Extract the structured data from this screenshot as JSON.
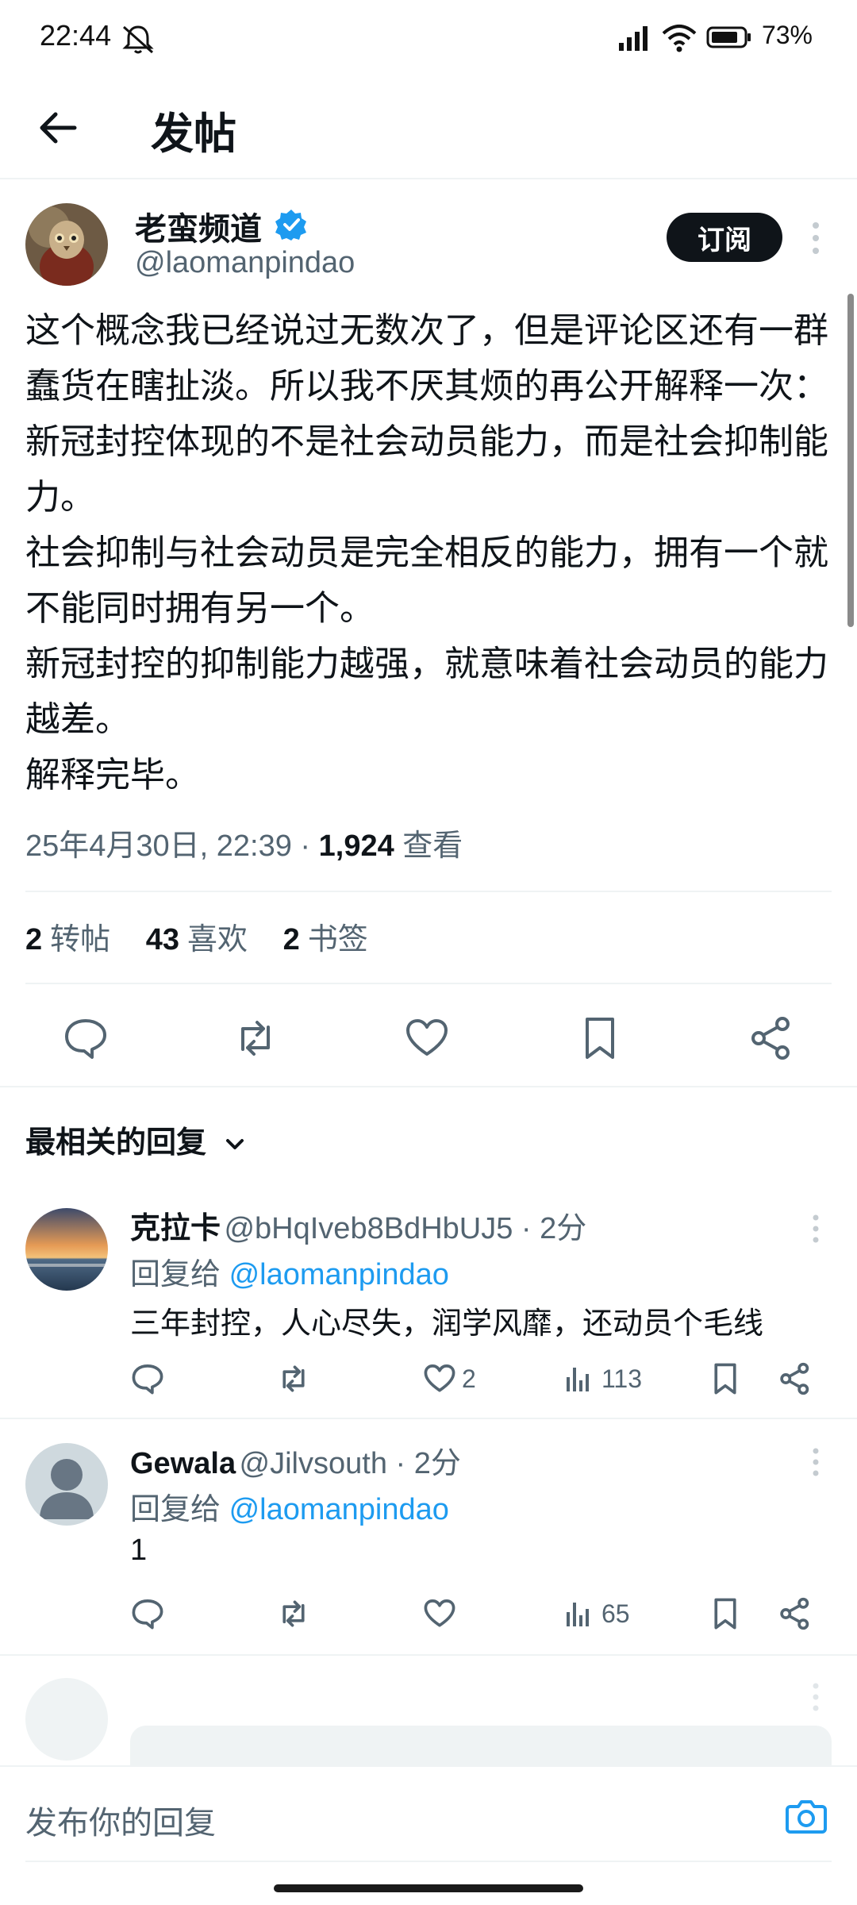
{
  "status_bar": {
    "time": "22:44",
    "battery": "73%"
  },
  "header": {
    "title": "发帖"
  },
  "post": {
    "author_name": "老蛮频道",
    "author_handle": "@laomanpindao",
    "subscribe_label": "订阅",
    "text": "这个概念我已经说过无数次了，但是评论区还有一群蠢货在瞎扯淡。所以我不厌其烦的再公开解释一次：新冠封控体现的不是社会动员能力，而是社会抑制能力。\n社会抑制与社会动员是完全相反的能力，拥有一个就不能同时拥有另一个。\n新冠封控的抑制能力越强，就意味着社会动员的能力越差。\n解释完毕。",
    "timestamp": "25年4月30日, 22:39 · ",
    "views_count": "1,924",
    "views_label": " 查看",
    "stats": {
      "reposts_count": "2",
      "reposts_label": "转帖",
      "likes_count": "43",
      "likes_label": "喜欢",
      "bookmarks_count": "2",
      "bookmarks_label": "书签"
    }
  },
  "replies_section": {
    "sort_label": "最相关的回复"
  },
  "replies": [
    {
      "name": "克拉卡",
      "handle": "@bHqIveb8BdHbUJ5 · 2分",
      "reply_to_prefix": "回复给 ",
      "reply_to_mention": "@laomanpindao",
      "body": "三年封控，人心尽失，润学风靡，还动员个毛线",
      "likes": "2",
      "views": "113"
    },
    {
      "name": "Gewala",
      "handle": "@Jilvsouth · 2分",
      "reply_to_prefix": "回复给 ",
      "reply_to_mention": "@laomanpindao",
      "body": "1",
      "likes": "",
      "views": "65"
    }
  ],
  "compose": {
    "placeholder": "发布你的回复"
  },
  "colors": {
    "accent": "#1d9bf0",
    "text": "#0f1419",
    "secondary": "#536471",
    "divider": "#eff3f4"
  }
}
